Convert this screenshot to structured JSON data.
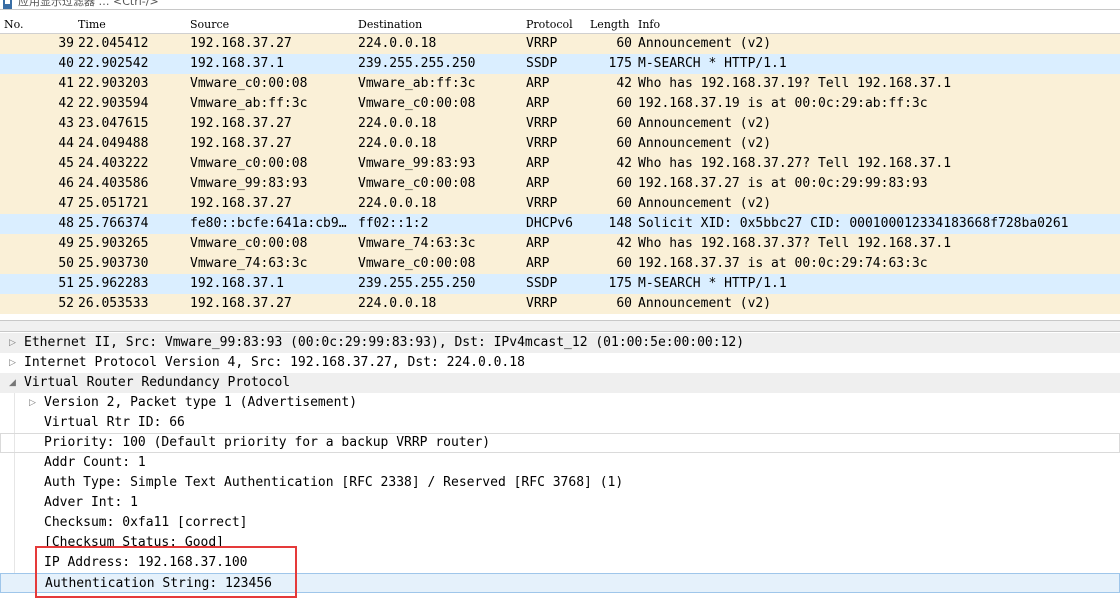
{
  "filter": {
    "placeholder": "应用显示过滤器 … <Ctrl-/>"
  },
  "columns": [
    "No.",
    "Time",
    "Source",
    "Destination",
    "Protocol",
    "Length",
    "Info"
  ],
  "packets": [
    {
      "no": "39",
      "time": "22.045412",
      "src": "192.168.37.27",
      "dst": "224.0.0.18",
      "proto": "VRRP",
      "len": "60",
      "info": "Announcement (v2)",
      "kind": "vrrp"
    },
    {
      "no": "40",
      "time": "22.902542",
      "src": "192.168.37.1",
      "dst": "239.255.255.250",
      "proto": "SSDP",
      "len": "175",
      "info": "M-SEARCH * HTTP/1.1",
      "kind": "udp"
    },
    {
      "no": "41",
      "time": "22.903203",
      "src": "Vmware_c0:00:08",
      "dst": "Vmware_ab:ff:3c",
      "proto": "ARP",
      "len": "42",
      "info": "Who has 192.168.37.19? Tell 192.168.37.1",
      "kind": "arp"
    },
    {
      "no": "42",
      "time": "22.903594",
      "src": "Vmware_ab:ff:3c",
      "dst": "Vmware_c0:00:08",
      "proto": "ARP",
      "len": "60",
      "info": "192.168.37.19 is at 00:0c:29:ab:ff:3c",
      "kind": "arp"
    },
    {
      "no": "43",
      "time": "23.047615",
      "src": "192.168.37.27",
      "dst": "224.0.0.18",
      "proto": "VRRP",
      "len": "60",
      "info": "Announcement (v2)",
      "kind": "vrrp"
    },
    {
      "no": "44",
      "time": "24.049488",
      "src": "192.168.37.27",
      "dst": "224.0.0.18",
      "proto": "VRRP",
      "len": "60",
      "info": "Announcement (v2)",
      "kind": "vrrp"
    },
    {
      "no": "45",
      "time": "24.403222",
      "src": "Vmware_c0:00:08",
      "dst": "Vmware_99:83:93",
      "proto": "ARP",
      "len": "42",
      "info": "Who has 192.168.37.27? Tell 192.168.37.1",
      "kind": "arp"
    },
    {
      "no": "46",
      "time": "24.403586",
      "src": "Vmware_99:83:93",
      "dst": "Vmware_c0:00:08",
      "proto": "ARP",
      "len": "60",
      "info": "192.168.37.27 is at 00:0c:29:99:83:93",
      "kind": "arp"
    },
    {
      "no": "47",
      "time": "25.051721",
      "src": "192.168.37.27",
      "dst": "224.0.0.18",
      "proto": "VRRP",
      "len": "60",
      "info": "Announcement (v2)",
      "kind": "vrrp"
    },
    {
      "no": "48",
      "time": "25.766374",
      "src": "fe80::bcfe:641a:cb9…",
      "dst": "ff02::1:2",
      "proto": "DHCPv6",
      "len": "148",
      "info": "Solicit XID: 0x5bbc27 CID: 000100012334183668f728ba0261",
      "kind": "udp"
    },
    {
      "no": "49",
      "time": "25.903265",
      "src": "Vmware_c0:00:08",
      "dst": "Vmware_74:63:3c",
      "proto": "ARP",
      "len": "42",
      "info": "Who has 192.168.37.37? Tell 192.168.37.1",
      "kind": "arp"
    },
    {
      "no": "50",
      "time": "25.903730",
      "src": "Vmware_74:63:3c",
      "dst": "Vmware_c0:00:08",
      "proto": "ARP",
      "len": "60",
      "info": "192.168.37.37 is at 00:0c:29:74:63:3c",
      "kind": "arp"
    },
    {
      "no": "51",
      "time": "25.962283",
      "src": "192.168.37.1",
      "dst": "239.255.255.250",
      "proto": "SSDP",
      "len": "175",
      "info": "M-SEARCH * HTTP/1.1",
      "kind": "udp"
    },
    {
      "no": "52",
      "time": "26.053533",
      "src": "192.168.37.27",
      "dst": "224.0.0.18",
      "proto": "VRRP",
      "len": "60",
      "info": "Announcement (v2)",
      "kind": "vrrp"
    }
  ],
  "details": [
    {
      "text": "Ethernet II, Src: Vmware_99:83:93 (00:0c:29:99:83:93), Dst: IPv4mcast_12 (01:00:5e:00:00:12)",
      "level": 0,
      "arrow": "collapsed",
      "style": "gray"
    },
    {
      "text": "Internet Protocol Version 4, Src: 192.168.37.27, Dst: 224.0.0.18",
      "level": 0,
      "arrow": "collapsed",
      "style": ""
    },
    {
      "text": "Virtual Router Redundancy Protocol",
      "level": 0,
      "arrow": "expanded",
      "style": "gray"
    },
    {
      "text": "Version 2, Packet type 1 (Advertisement)",
      "level": 1,
      "arrow": "collapsed",
      "style": ""
    },
    {
      "text": "Virtual Rtr ID: 66",
      "level": 1,
      "arrow": "",
      "style": ""
    },
    {
      "text": "Priority: 100 (Default priority for a backup VRRP router)",
      "level": 1,
      "arrow": "",
      "style": "boxed"
    },
    {
      "text": "Addr Count: 1",
      "level": 1,
      "arrow": "",
      "style": ""
    },
    {
      "text": "Auth Type: Simple Text Authentication [RFC 2338] / Reserved [RFC 3768] (1)",
      "level": 1,
      "arrow": "",
      "style": ""
    },
    {
      "text": "Adver Int: 1",
      "level": 1,
      "arrow": "",
      "style": ""
    },
    {
      "text": "Checksum: 0xfa11 [correct]",
      "level": 1,
      "arrow": "",
      "style": ""
    },
    {
      "text": "[Checksum Status: Good]",
      "level": 1,
      "arrow": "",
      "style": ""
    },
    {
      "text": "IP Address: 192.168.37.100",
      "level": 1,
      "arrow": "",
      "style": ""
    },
    {
      "text": "Authentication String: 123456",
      "level": 1,
      "arrow": "",
      "style": "sel"
    }
  ],
  "colors": {
    "arp_vrrp_row": "#faf0d7",
    "udp_row": "#daeeff",
    "selected_row": "#e5f1fb",
    "annotation_box": "#e53a3a"
  },
  "icons": {
    "filter": "bookmark-icon",
    "collapsed": "triangle-right-icon",
    "expanded": "triangle-down-icon"
  }
}
